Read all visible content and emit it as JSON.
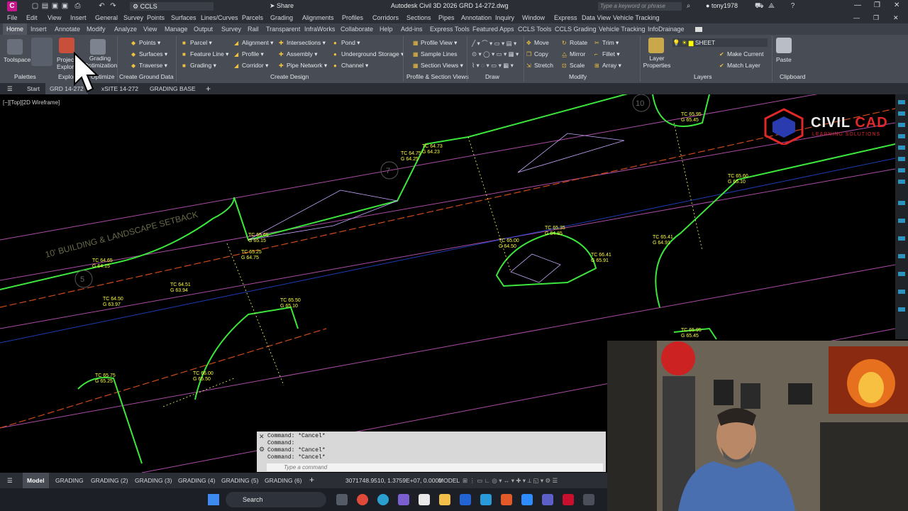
{
  "app": {
    "title": "Autodesk Civil 3D 2026   GRD 14-272.dwg",
    "workspace": "CCLS",
    "share": "Share",
    "keyword_placeholder": "Type a keyword or phrase",
    "user": "tony1978",
    "accent": "#c4178c"
  },
  "menubar": [
    "File",
    "Edit",
    "View",
    "Insert",
    "General",
    "Survey",
    "Points",
    "Surfaces",
    "Lines/Curves",
    "Parcels",
    "Grading",
    "Alignments",
    "Profiles",
    "Corridors",
    "Sections",
    "Pipes",
    "Annotation",
    "Inquiry",
    "Window",
    "Express",
    "Data View",
    "Vehicle Tracking"
  ],
  "ribbon_tabs": [
    "Home",
    "Insert",
    "Annotate",
    "Modify",
    "Analyze",
    "View",
    "Manage",
    "Output",
    "Survey",
    "Rail",
    "Transparent",
    "InfraWorks",
    "Collaborate",
    "Help",
    "Add-ins",
    "Express Tools",
    "Featured Apps",
    "CCLS Tools",
    "CCLS Grading",
    "Vehicle Tracking",
    "InfoDrainage"
  ],
  "ribbon": {
    "toolspace": "Toolspace",
    "project_explorer": "Project Explorer",
    "grading_optimization": "Grading Optimization",
    "palettes": "Palettes",
    "explore": "Explore",
    "optimize": "Optimize",
    "create_ground": [
      "Points",
      "Surfaces",
      "Traverse"
    ],
    "create_ground_title": "Create Ground Data",
    "design1": [
      "Parcel",
      "Feature Line",
      "Grading"
    ],
    "design2": [
      "Alignment",
      "Profile",
      "Corridor"
    ],
    "design3": [
      "Intersections",
      "Assembly",
      "Pipe Network"
    ],
    "design4": [
      "Pond",
      "Underground Storage",
      "Channel"
    ],
    "create_design_title": "Create Design",
    "pfsv": [
      "Profile View",
      "Sample Lines",
      "Section Views"
    ],
    "pfsv_title": "Profile & Section Views",
    "draw_title": "Draw",
    "modify1": [
      "Move",
      "Copy",
      "Stretch"
    ],
    "modify2": [
      "Rotate",
      "Mirror",
      "Scale"
    ],
    "modify3": [
      "Trim",
      "Fillet",
      "Array"
    ],
    "modify_title": "Modify",
    "layer_name": "SHEET",
    "layer_props": "Layer Properties",
    "make_current": "Make Current",
    "match_layer": "Match Layer",
    "layers_title": "Layers",
    "paste": "Paste",
    "clipboard_title": "Clipboard"
  },
  "doc_tabs": [
    "Start",
    "GRD 14-272",
    "xSITE 14-272",
    "GRADING BASE"
  ],
  "viewport_label": "[−][Top][2D Wireframe]",
  "logo": {
    "civil": "CIVIL",
    "cad": "CAD",
    "tagline": "LEARNING SOLUTIONS"
  },
  "drawing_labels": [
    {
      "t": "TC 64.75",
      "g": "G 64.25"
    },
    {
      "t": "TC 64.65",
      "g": "G 64.15"
    },
    {
      "t": "TC 65.65",
      "g": "G 65.15"
    },
    {
      "t": "TC 65.35",
      "g": "G 64.85"
    },
    {
      "t": "TC 65.50",
      "g": "G 65.10"
    },
    {
      "t": "TC 64.50",
      "g": "G 63.97"
    },
    {
      "t": "TC 64.51",
      "g": "G 63.94"
    },
    {
      "t": "TC 65.00",
      "g": "G 64.50"
    },
    {
      "t": "TC 66.00",
      "g": "G 65.50"
    },
    {
      "t": "TC 65.75",
      "g": "G 65.25"
    },
    {
      "t": "TC 65.41",
      "g": "G 64.91"
    },
    {
      "t": "TC 66.41",
      "g": "G 65.91"
    },
    {
      "t": "TC 65.95",
      "g": "G 65.45"
    },
    {
      "t": "TC 65.60",
      "g": "G 65.10"
    },
    {
      "t": "TC 64.73",
      "g": "G 64.23"
    },
    {
      "t": "TC 65.25",
      "g": "G 64.75"
    },
    {
      "t": "TC 65.95",
      "g": "G 65.45"
    }
  ],
  "drawing_text": {
    "setback": "10' BUILDING & LANDSCAPE SETBACK",
    "n5": "5",
    "n7": "7",
    "n10": "10"
  },
  "command": {
    "lines": [
      "Command: *Cancel*",
      "Command:",
      "Command: *Cancel*",
      "Command: *Cancel*"
    ],
    "placeholder": "Type a command"
  },
  "status": {
    "layouts": [
      "Model",
      "GRADING",
      "GRADING (2)",
      "GRADING (3)",
      "GRADING (4)",
      "GRADING (5)",
      "GRADING (6)"
    ],
    "coords": "3071748.9510, 1.3759E+07, 0.0000",
    "mode": "MODEL"
  },
  "taskbar": {
    "search": "Search"
  }
}
